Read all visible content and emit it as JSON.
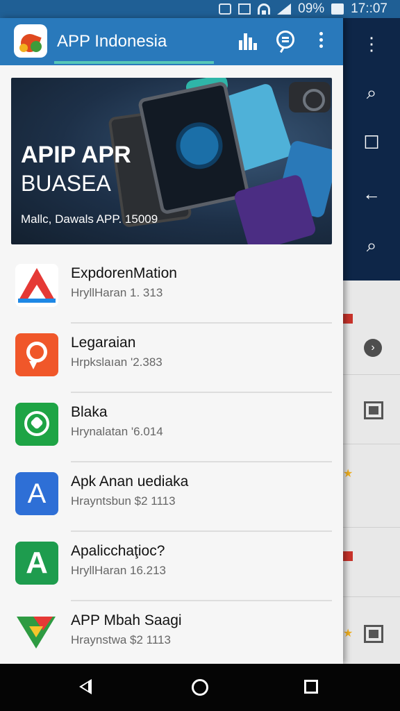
{
  "status_bar": {
    "battery": "09%",
    "time": "17::07"
  },
  "header": {
    "title": "APP Indonesia"
  },
  "banner": {
    "title_line1": "APIP APR",
    "title_line2": "BUASEA",
    "subtitle": "Mallc, Dawals APP. 15009"
  },
  "apps": [
    {
      "name": "ExpdorenMation",
      "meta": "HryllHaran 1. 313",
      "icon": "drive-triangle-icon"
    },
    {
      "name": "Legaraian",
      "meta": "Hrpkslaıan '2.383",
      "icon": "orange-pin-icon"
    },
    {
      "name": "Blaka",
      "meta": "Hrynalatan '6.014",
      "icon": "whatsapp-icon"
    },
    {
      "name": "Apk Anan uediaka",
      "meta": "Hrayntsbun $2 1113",
      "icon": "translate-a-icon"
    },
    {
      "name": "Apalicchaţioc?",
      "meta": "HryllHaran 16.213",
      "icon": "green-a-icon"
    },
    {
      "name": "APP Mbah Saagi",
      "meta": "Hraynstwa $2 1113",
      "icon": "play-store-icon"
    }
  ],
  "colors": {
    "header": "#2979bb",
    "status": "#1f5f95",
    "accent_underline": "#56c7b8",
    "right_toolbar": "#0e2648"
  }
}
